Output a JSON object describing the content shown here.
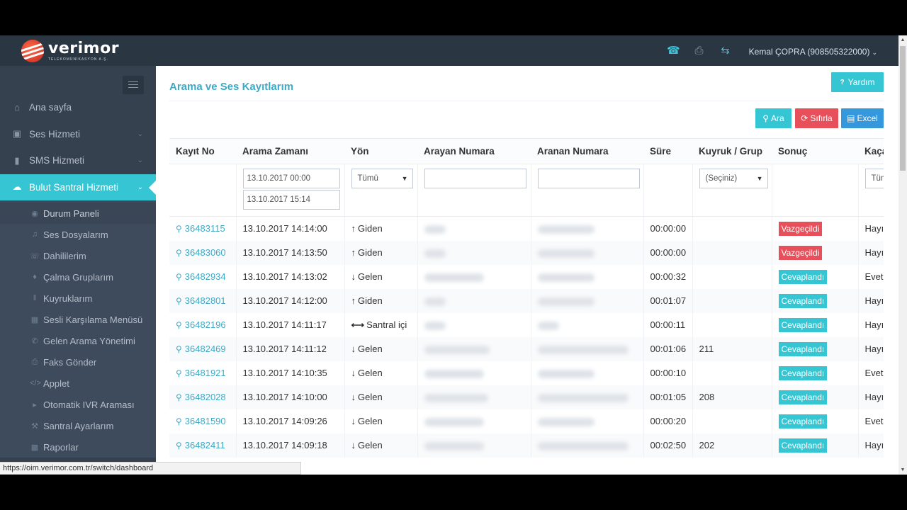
{
  "header": {
    "logo_name": "verimor",
    "logo_sub": "TELEKOMÜNİKASYON A.Ş.",
    "user": "Kemal ÇOPRA (908505322000)",
    "icons": [
      "phone-icon",
      "fax-icon",
      "transfer-icon"
    ]
  },
  "sidebar": {
    "items": [
      {
        "label": "Ana sayfa",
        "icon": "home-icon"
      },
      {
        "label": "Ses Hizmeti",
        "icon": "voice-icon"
      },
      {
        "label": "SMS Hizmeti",
        "icon": "mobile-icon"
      },
      {
        "label": "Bulut Santral Hizmeti",
        "icon": "cloud-icon",
        "active": true
      }
    ],
    "sub_items": [
      {
        "label": "Durum Paneli",
        "icon": "dashboard-icon"
      },
      {
        "label": "Ses Dosyalarım",
        "icon": "music-icon"
      },
      {
        "label": "Dahililerim",
        "icon": "phone-icon"
      },
      {
        "label": "Çalma Gruplarım",
        "icon": "bell-icon"
      },
      {
        "label": "Kuyruklarım",
        "icon": "queue-icon"
      },
      {
        "label": "Sesli Karşılama Menüsü",
        "icon": "grid-icon"
      },
      {
        "label": "Gelen Arama Yönetimi",
        "icon": "incoming-call-icon"
      },
      {
        "label": "Faks Gönder",
        "icon": "fax-icon"
      },
      {
        "label": "Applet",
        "icon": "code-icon"
      },
      {
        "label": "Otomatik IVR Araması",
        "icon": "bullhorn-icon"
      },
      {
        "label": "Santral Ayarlarım",
        "icon": "wrench-icon"
      },
      {
        "label": "Raporlar",
        "icon": "chart-icon"
      }
    ]
  },
  "main": {
    "title": "Arama ve Ses Kayıtlarım",
    "help_label": "Yardım",
    "search_label": "Ara",
    "reset_label": "Sıfırla",
    "excel_label": "Excel",
    "columns": [
      "Kayıt No",
      "Arama Zamanı",
      "Yön",
      "Arayan Numara",
      "Aranan Numara",
      "Süre",
      "Kuyruk / Grup",
      "Sonuç",
      "Kaçan"
    ],
    "filters": {
      "date_from": "13.10.2017 00:00",
      "date_to": "13.10.2017 15:14",
      "direction": "Tümü",
      "queue": "(Seçiniz)",
      "missed": "Tümü"
    },
    "rows": [
      {
        "id": "36483115",
        "time": "13.10.2017 14:14:00",
        "dir": "Giden",
        "dir_icon": "arrow-up-icon",
        "duration": "00:00:00",
        "queue": "",
        "result": "Vazgeçildi",
        "result_color": "red",
        "missed": "Hayır"
      },
      {
        "id": "36483060",
        "time": "13.10.2017 14:13:50",
        "dir": "Giden",
        "dir_icon": "arrow-up-icon",
        "duration": "00:00:00",
        "queue": "",
        "result": "Vazgeçildi",
        "result_color": "red",
        "missed": "Hayır"
      },
      {
        "id": "36482934",
        "time": "13.10.2017 14:13:02",
        "dir": "Gelen",
        "dir_icon": "arrow-down-icon",
        "duration": "00:00:32",
        "queue": "",
        "result": "Cevaplandı",
        "result_color": "cyan",
        "missed": "Evet"
      },
      {
        "id": "36482801",
        "time": "13.10.2017 14:12:00",
        "dir": "Giden",
        "dir_icon": "arrow-up-icon",
        "duration": "00:01:07",
        "queue": "",
        "result": "Cevaplandı",
        "result_color": "cyan",
        "missed": "Hayır"
      },
      {
        "id": "36482196",
        "time": "13.10.2017 14:11:17",
        "dir": "Santral içi",
        "dir_icon": "arrow-both-icon",
        "duration": "00:00:11",
        "queue": "",
        "result": "Cevaplandı",
        "result_color": "cyan",
        "missed": "Hayır"
      },
      {
        "id": "36482469",
        "time": "13.10.2017 14:11:12",
        "dir": "Gelen",
        "dir_icon": "arrow-down-icon",
        "duration": "00:01:06",
        "queue": "211",
        "result": "Cevaplandı",
        "result_color": "cyan",
        "missed": "Hayır"
      },
      {
        "id": "36481921",
        "time": "13.10.2017 14:10:35",
        "dir": "Gelen",
        "dir_icon": "arrow-down-icon",
        "duration": "00:00:10",
        "queue": "",
        "result": "Cevaplandı",
        "result_color": "cyan",
        "missed": "Evet"
      },
      {
        "id": "36482028",
        "time": "13.10.2017 14:10:00",
        "dir": "Gelen",
        "dir_icon": "arrow-down-icon",
        "duration": "00:01:05",
        "queue": "208",
        "result": "Cevaplandı",
        "result_color": "cyan",
        "missed": "Hayır"
      },
      {
        "id": "36481590",
        "time": "13.10.2017 14:09:26",
        "dir": "Gelen",
        "dir_icon": "arrow-down-icon",
        "duration": "00:00:20",
        "queue": "",
        "result": "Cevaplandı",
        "result_color": "cyan",
        "missed": "Evet"
      },
      {
        "id": "36482411",
        "time": "13.10.2017 14:09:18",
        "dir": "Gelen",
        "dir_icon": "arrow-down-icon",
        "duration": "00:02:50",
        "queue": "202",
        "result": "Cevaplandı",
        "result_color": "cyan",
        "missed": "Hayır"
      }
    ]
  },
  "statusbar": {
    "url": "https://oim.verimor.com.tr/switch/dashboard"
  },
  "colors": {
    "accent": "#36c6d3",
    "danger": "#e7505a",
    "primary": "#3598dc",
    "topbar": "#2b3643",
    "sidebar": "#364150",
    "title": "#3fa9c5"
  }
}
